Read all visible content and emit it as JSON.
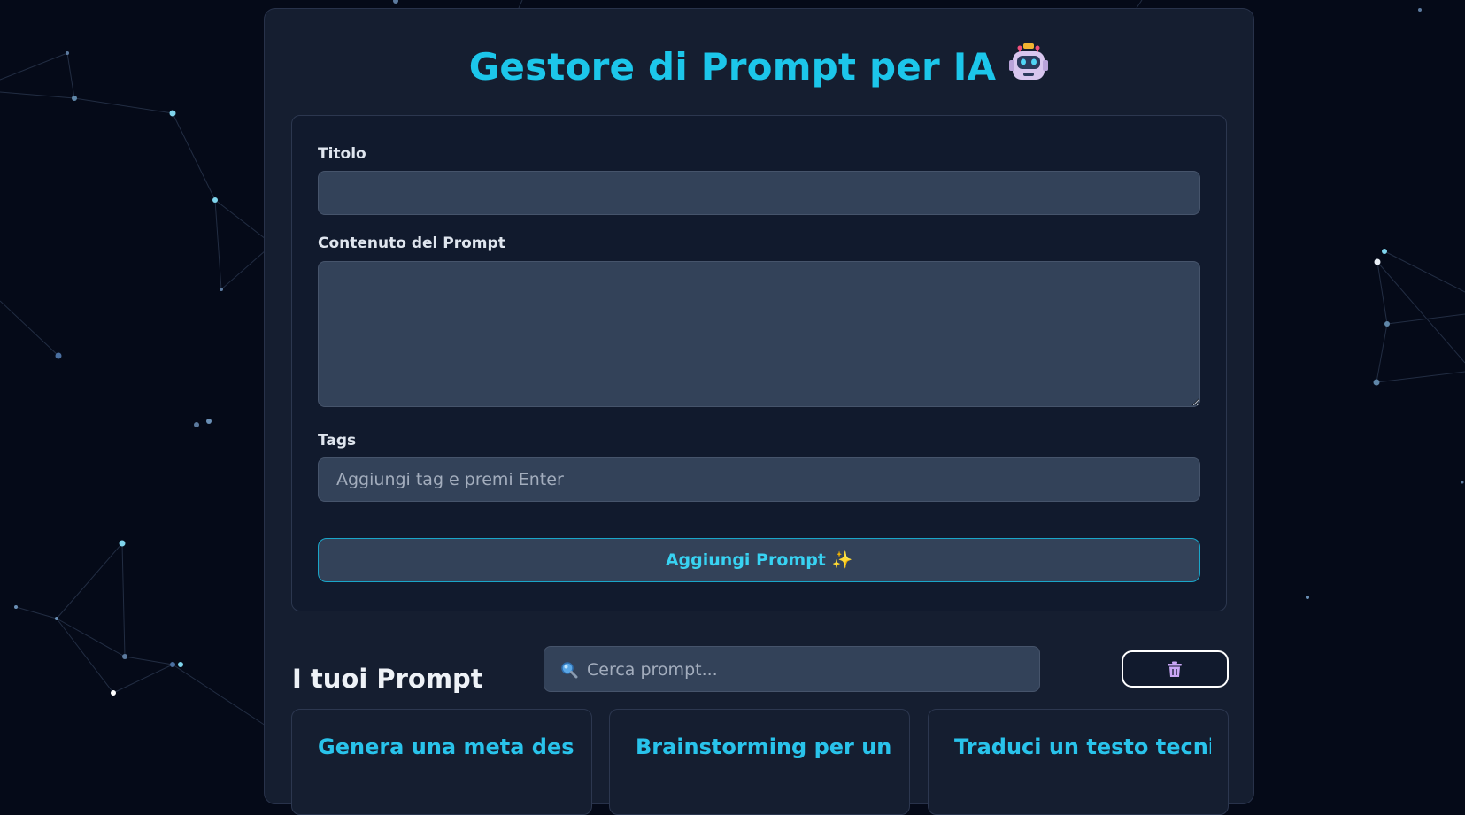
{
  "app": {
    "title": "Gestore di Prompt per IA",
    "title_icon": "robot-icon",
    "accent_color": "#1cc6ea"
  },
  "form": {
    "title_label": "Titolo",
    "title_value": "",
    "content_label": "Contenuto del Prompt",
    "content_value": "",
    "tags_label": "Tags",
    "tags_placeholder": "Aggiungi tag e premi Enter",
    "add_button_label": "Aggiungi Prompt ✨"
  },
  "prompts_section": {
    "heading": "I tuoi Prompt",
    "search_placeholder": "Cerca prompt...",
    "search_icon": "magnifier-icon",
    "clear_button_icon": "trash-icon"
  },
  "prompt_cards": [
    {
      "title": "Genera una meta desc..."
    },
    {
      "title": "Brainstorming per un ..."
    },
    {
      "title": "Traduci un testo tecnico"
    }
  ]
}
